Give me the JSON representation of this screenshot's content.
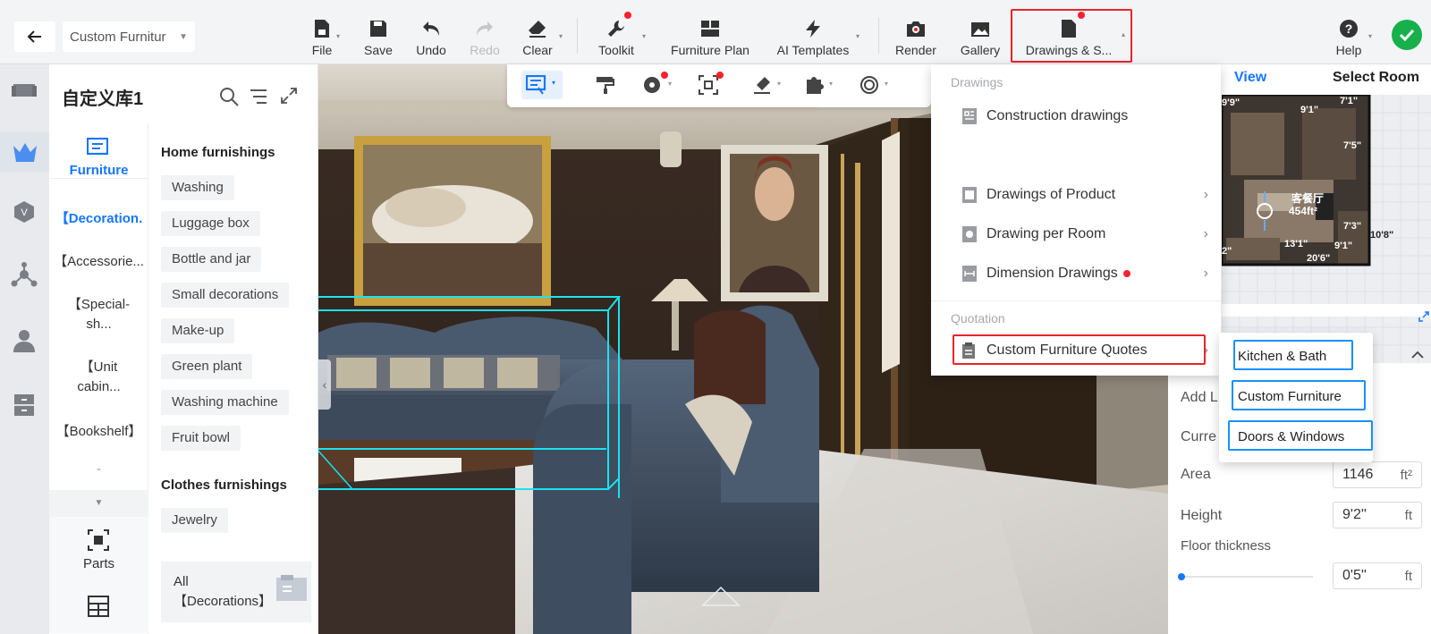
{
  "header": {
    "project_name": "Custom Furnitur",
    "toolbar": {
      "file": "File",
      "save": "Save",
      "undo": "Undo",
      "redo": "Redo",
      "clear": "Clear",
      "toolkit": "Toolkit",
      "furniture_plan": "Furniture Plan",
      "ai_templates": "AI Templates",
      "render": "Render",
      "gallery": "Gallery",
      "drawings": "Drawings & S...",
      "help": "Help"
    }
  },
  "library": {
    "title": "自定义库1",
    "furniture_tab": "Furniture",
    "categories": [
      "【Decoration.",
      "【Accessorie...",
      "【Special-sh...",
      "【Unit cabin...",
      "【Bookshelf】",
      "-"
    ],
    "parts_label": "Parts",
    "home_section": "Home furnishings",
    "home_items": [
      "Washing",
      "Luggage box",
      "Bottle and jar",
      "Small decorations",
      "Make-up",
      "Green plant",
      "Washing machine",
      "Fruit bowl"
    ],
    "clothes_section": "Clothes furnishings",
    "clothes_items": [
      "Jewelry"
    ],
    "all_card": "All\n【Decorations】"
  },
  "drawings_menu": {
    "drawings_header": "Drawings",
    "construction": "Construction drawings",
    "product": "Drawings of Product",
    "per_room": "Drawing per Room",
    "dimension": "Dimension Drawings",
    "quotation_header": "Quotation",
    "custom_quotes": "Custom Furniture Quotes"
  },
  "quotes_submenu": [
    "Kitchen & Bath",
    "Custom Furniture",
    "Doors & Windows"
  ],
  "right_panel": {
    "view_tab": "View",
    "select_room_tab": "Select Room",
    "minimap_room_name": "客餐厅",
    "minimap_room_area": "454ft²",
    "minimap_labels": [
      "9'9\"",
      "9'1\"",
      "7'1\"",
      "7'5\"",
      "13'1\"",
      "7'3\"",
      "9'1\"",
      "10'8\"",
      "20'6\"",
      "2\""
    ],
    "section_title_fragment": "el",
    "add_fragment": "Add L",
    "current_fragment": "Curre",
    "area_label": "Area",
    "area_value": "1146",
    "area_unit": "ft²",
    "height_label": "Height",
    "height_value": "9'2''",
    "height_unit": "ft",
    "floor_label": "Floor thickness",
    "floor_value": "0'5''",
    "floor_unit": "ft"
  },
  "colors": {
    "accent_blue": "#1890ff",
    "highlight_red": "#e8242b",
    "notification_dot": "#f5222d",
    "confirm_green": "#17b04b",
    "selection_cyan": "#19e3f0"
  }
}
